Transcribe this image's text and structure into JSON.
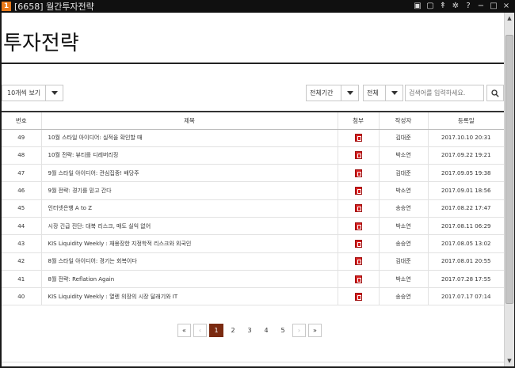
{
  "window": {
    "badge": "1",
    "title": "[6658] 월간투자전략",
    "controls": [
      "▣",
      "▢",
      "↟",
      "✲",
      "?",
      "−",
      "□",
      "×"
    ]
  },
  "page": {
    "title": "투자전략"
  },
  "filters": {
    "view_count": "10개씩 보기",
    "period": "전체기간",
    "scope": "전체",
    "search_placeholder": "검색어를 입력하세요."
  },
  "table": {
    "headers": {
      "no": "번호",
      "title": "제목",
      "attach": "첨부",
      "author": "작성자",
      "date": "등록일"
    },
    "rows": [
      {
        "no": "49",
        "title": "10월 스타일 아이디어: 실적을 확인할 때",
        "author": "김대준",
        "date": "2017.10.10 20:31"
      },
      {
        "no": "48",
        "title": "10월 전략: 뷰티를 디레버리징",
        "author": "박소연",
        "date": "2017.09.22 19:21"
      },
      {
        "no": "47",
        "title": "9월 스타일 아이디어: 관심집중! 배당주",
        "author": "김대준",
        "date": "2017.09.05 19:38"
      },
      {
        "no": "46",
        "title": "9월 전략: 경기를 믿고 간다",
        "author": "박소연",
        "date": "2017.09.01 18:56"
      },
      {
        "no": "45",
        "title": "인터넷은행 A to Z",
        "author": "송승연",
        "date": "2017.08.22 17:47"
      },
      {
        "no": "44",
        "title": "시장 긴급 진단: 대북 리스크, 매도 실익 없어",
        "author": "박소연",
        "date": "2017.08.11 06:29"
      },
      {
        "no": "43",
        "title": "KIS Liquidity Weekly : 재용장한 지정학적 리스크와 외국인",
        "author": "송승연",
        "date": "2017.08.05 13:02"
      },
      {
        "no": "42",
        "title": "8월 스타일 아이디어: 경기는 회복이다",
        "author": "김대준",
        "date": "2017.08.01 20:55"
      },
      {
        "no": "41",
        "title": "8월 전략: Reflation Again",
        "author": "박소연",
        "date": "2017.07.28 17:55"
      },
      {
        "no": "40",
        "title": "KIS Liquidity Weekly : 열렌 의장의 시장 달래기와 IT",
        "author": "송승연",
        "date": "2017.07.17 07:14"
      }
    ]
  },
  "pagination": {
    "first": "«",
    "prev": "‹",
    "pages": [
      "1",
      "2",
      "3",
      "4",
      "5"
    ],
    "current": "1",
    "next": "›",
    "last": "»"
  }
}
